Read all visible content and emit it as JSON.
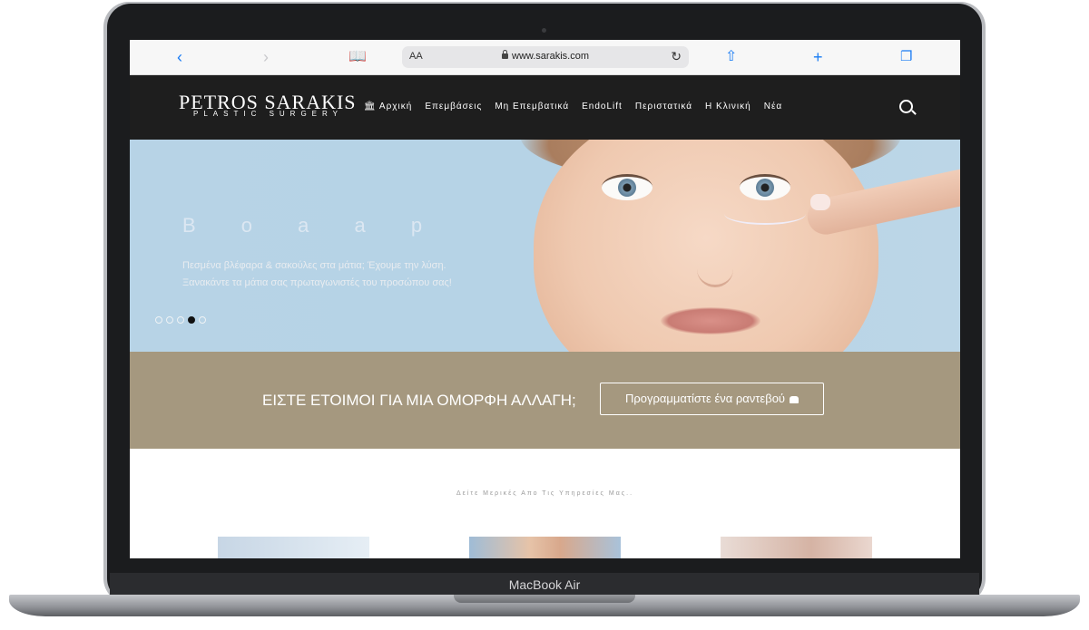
{
  "device": {
    "label": "MacBook Air"
  },
  "browser": {
    "aa_label": "AA",
    "url": "www.sarakis.com",
    "back_icon": "chevron-left-icon",
    "forward_icon": "chevron-right-icon",
    "bookmarks_icon": "book-icon",
    "reload_icon": "reload-icon",
    "share_icon": "share-icon",
    "new_tab_icon": "plus-icon",
    "tabs_icon": "tabs-icon"
  },
  "site": {
    "logo": {
      "main": "PETROS SARAKIS",
      "sub": "PLASTIC SURGERY"
    },
    "menu": [
      {
        "label": "🏛 Αρχική"
      },
      {
        "label": "Επεμβάσεις"
      },
      {
        "label": "Μη Επεμβατικά"
      },
      {
        "label": "EndoLift"
      },
      {
        "label": "Περιστατικά"
      },
      {
        "label": "Η Κλινική"
      },
      {
        "label": "Νέα"
      }
    ],
    "hero": {
      "title": "B o a a p",
      "subtitle_line1": "Πεσμένα βλέφαρα & σακούλες στα μάτια; Έχουμε την λύση.",
      "subtitle_line2": "Ξανακάντε τα μάτια σας πρωταγωνιστές του προσώπου σας!",
      "slides_total": 5,
      "active_slide": 4
    },
    "cta": {
      "text": "ΕΙΣΤΕ ΕΤΟΙΜΟΙ ΓΙΑ ΜΙΑ ΟΜΟΡΦΗ ΑΛΛΑΓΗ;",
      "button_label": "Προγραμματίστε ένα ραντεβού"
    },
    "services": {
      "label": "Δείτε Μερικές Απο Τις Υπηρεσίες Μας.."
    }
  },
  "colors": {
    "nav_bg": "#1e1e1e",
    "cta_bg": "#a5987f",
    "link_blue": "#1a7cf4"
  }
}
